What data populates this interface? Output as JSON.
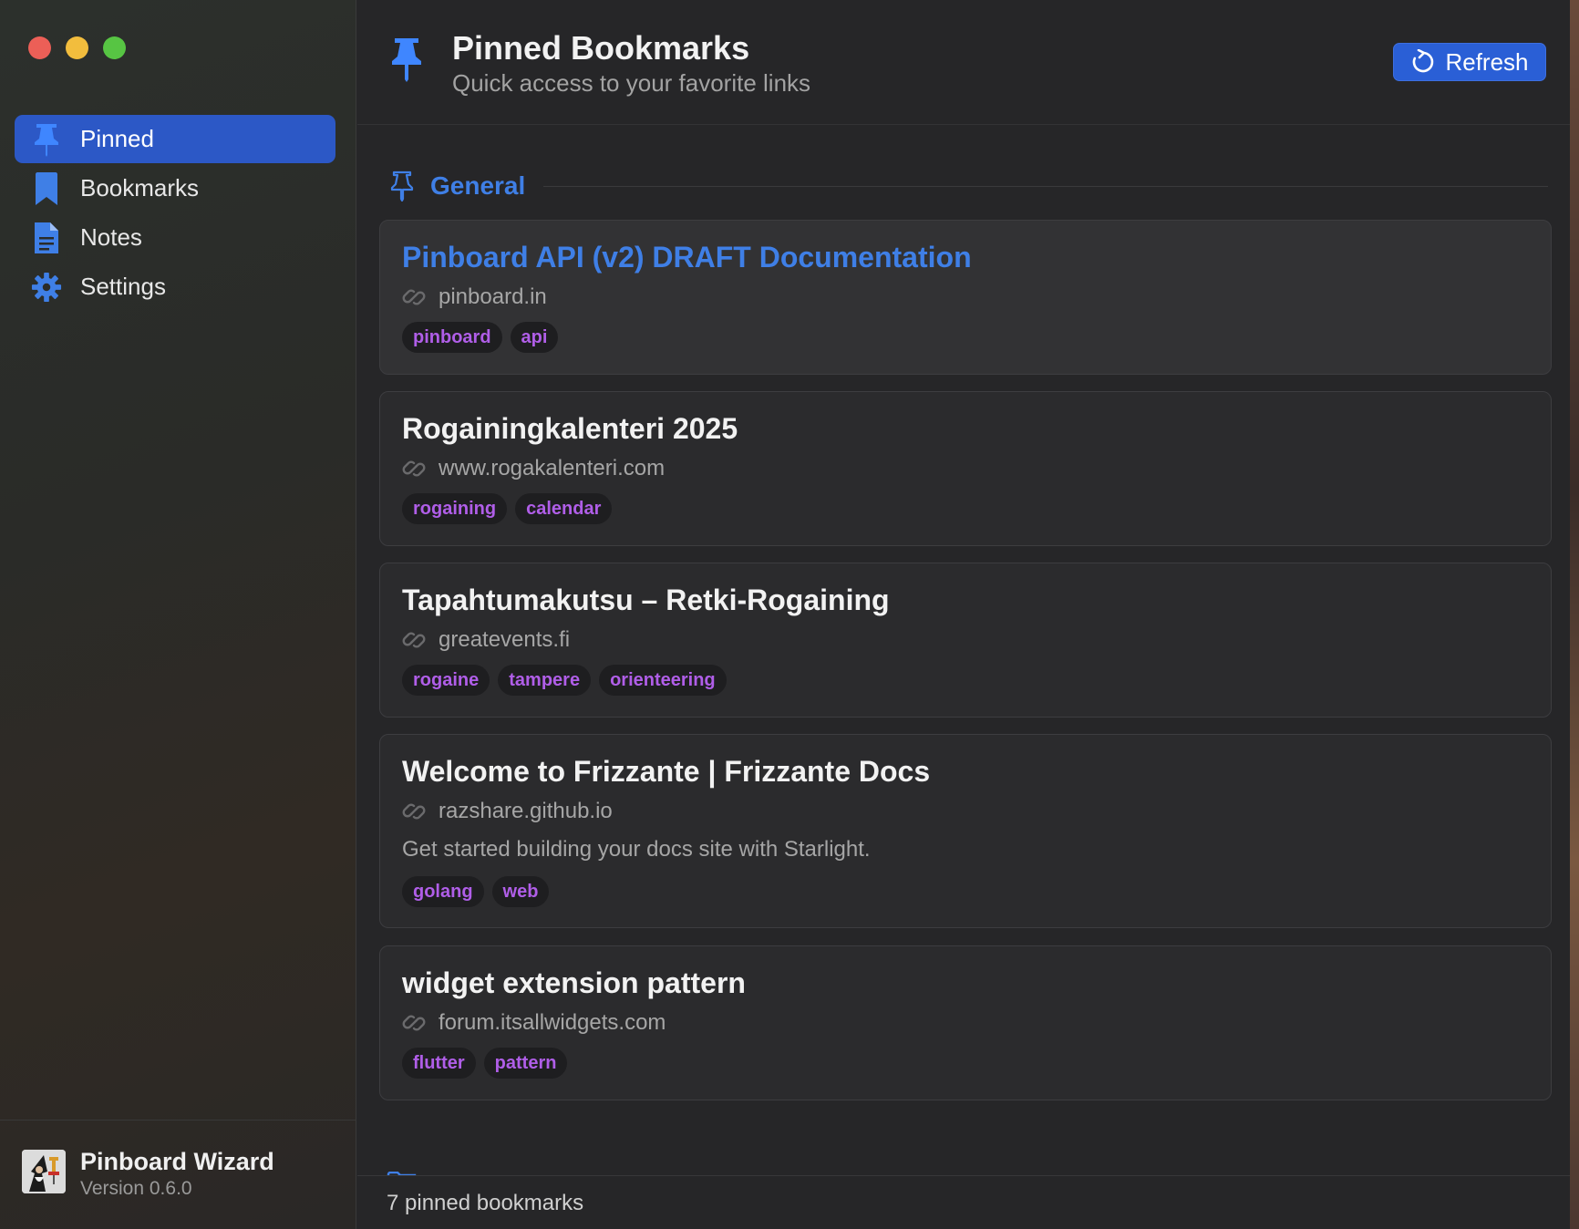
{
  "window": {
    "controls": [
      "close",
      "minimize",
      "maximize"
    ]
  },
  "sidebar": {
    "items": [
      {
        "label": "Pinned",
        "icon": "pin-icon",
        "active": true
      },
      {
        "label": "Bookmarks",
        "icon": "bookmark-icon",
        "active": false
      },
      {
        "label": "Notes",
        "icon": "document-icon",
        "active": false
      },
      {
        "label": "Settings",
        "icon": "gear-icon",
        "active": false
      }
    ],
    "footer": {
      "app_name": "Pinboard Wizard",
      "version": "Version 0.6.0"
    }
  },
  "header": {
    "title": "Pinned Bookmarks",
    "subtitle": "Quick access to your favorite links",
    "refresh_label": "Refresh"
  },
  "section": {
    "title": "General"
  },
  "bookmarks": [
    {
      "title": "Pinboard API (v2) DRAFT Documentation",
      "domain": "pinboard.in",
      "description": "",
      "tags": [
        "pinboard",
        "api"
      ]
    },
    {
      "title": "Rogainingkalenteri 2025",
      "domain": "www.rogakalenteri.com",
      "description": "",
      "tags": [
        "rogaining",
        "calendar"
      ]
    },
    {
      "title": "Tapahtumakutsu – Retki-Rogaining",
      "domain": "greatevents.fi",
      "description": "",
      "tags": [
        "rogaine",
        "tampere",
        "orienteering"
      ]
    },
    {
      "title": "Welcome to Frizzante | Frizzante Docs",
      "domain": "razshare.github.io",
      "description": "Get started building your docs site with Starlight.",
      "tags": [
        "golang",
        "web"
      ]
    },
    {
      "title": "widget extension pattern",
      "domain": "forum.itsallwidgets.com",
      "description": "",
      "tags": [
        "flutter",
        "pattern"
      ]
    }
  ],
  "status": {
    "text": "7 pinned bookmarks"
  },
  "colors": {
    "accent": "#3f7fe6",
    "active_nav": "#2c58c6",
    "tag_text": "#b05ee8",
    "button": "#2a5fd6"
  }
}
